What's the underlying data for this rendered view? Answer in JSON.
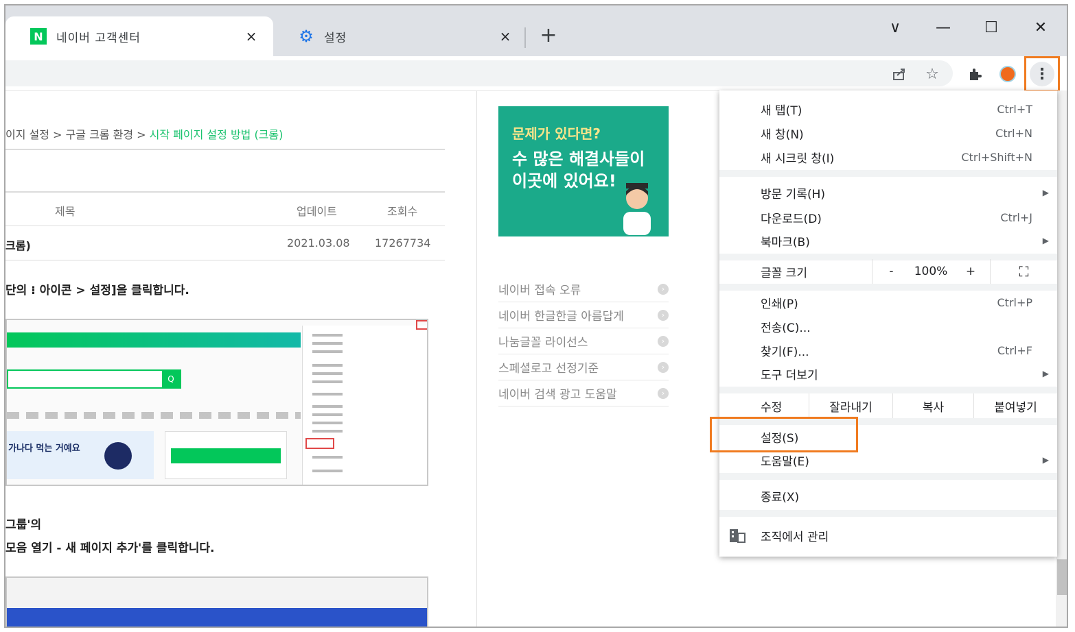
{
  "tabs": [
    {
      "title": "네이버 고객센터",
      "favicon": "naver-logo-icon",
      "active": true
    },
    {
      "title": "설정",
      "favicon": "gear-icon",
      "active": false
    }
  ],
  "new_tab_symbol": "+",
  "window_controls": {
    "dropdown": "∨",
    "minimize": "—",
    "maximize": "☐",
    "close": "✕"
  },
  "close_symbol": "×",
  "breadcrumb": {
    "items": [
      "이지 설정 >",
      "구글 크롬 환경 >"
    ],
    "current": "시작 페이지 설정 방법 (크롬)"
  },
  "table": {
    "headers": [
      "제목",
      "업데이트",
      "조회수"
    ],
    "row": {
      "title": "크롬)",
      "updated": "2021.03.08",
      "views": "17267734"
    }
  },
  "steps": {
    "step1": "단의 ⁝ 아이콘 > 설정]을 클릭합니다.",
    "step2a": "그룹'의",
    "step2b": "모음 열기 - 새 페이지 추가'를 클릭합니다."
  },
  "thumb1": {
    "ad_text": "가나다 먹는 거예요"
  },
  "ad": {
    "question": "문제가 있다면?",
    "line1": "수 많은 해결사들이",
    "line2": "이곳에 있어요!"
  },
  "sidebar_links": [
    "네이버 접속 오류",
    "네이버 한글한글 아름답게",
    "나눔글꼴 라이선스",
    "스페셜로고 선정기준",
    "네이버 검색 광고 도움말"
  ],
  "chrome_menu": {
    "new_tab": {
      "label": "새 탭(T)",
      "shortcut": "Ctrl+T"
    },
    "new_window": {
      "label": "새 창(N)",
      "shortcut": "Ctrl+N"
    },
    "incognito": {
      "label": "새 시크릿 창(I)",
      "shortcut": "Ctrl+Shift+N"
    },
    "history": {
      "label": "방문 기록(H)"
    },
    "downloads": {
      "label": "다운로드(D)",
      "shortcut": "Ctrl+J"
    },
    "bookmarks": {
      "label": "북마크(B)"
    },
    "zoom": {
      "label": "글꼴 크기",
      "minus": "-",
      "value": "100%",
      "plus": "+",
      "fullscreen": "⛶"
    },
    "print": {
      "label": "인쇄(P)",
      "shortcut": "Ctrl+P"
    },
    "cast": {
      "label": "전송(C)..."
    },
    "find": {
      "label": "찾기(F)...",
      "shortcut": "Ctrl+F"
    },
    "more_tools": {
      "label": "도구 더보기"
    },
    "edit": {
      "label": "수정",
      "cut": "잘라내기",
      "copy": "복사",
      "paste": "붙여넣기"
    },
    "settings": {
      "label": "설정(S)"
    },
    "help": {
      "label": "도움말(E)"
    },
    "exit": {
      "label": "종료(X)"
    },
    "managed": {
      "label": "조직에서 관리"
    }
  },
  "colors": {
    "highlight": "#f07b20",
    "naver_green": "#03c75a",
    "ad_bg": "#1baa8a"
  }
}
